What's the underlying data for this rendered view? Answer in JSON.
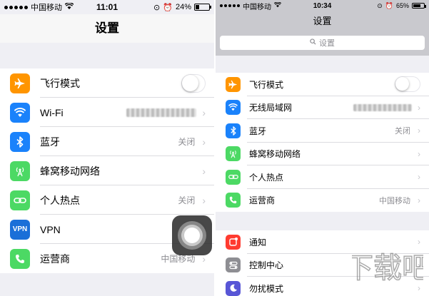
{
  "colors": {
    "airplane": "#ff9500",
    "wifi": "#1a82fb",
    "bluetooth": "#1a82fb",
    "cellular": "#4cd964",
    "hotspot": "#4cd964",
    "vpn": "#1a6fd8",
    "carrier": "#4cd964",
    "notifications": "#ff3b30",
    "control_center": "#8e8e93",
    "dnd": "#5856d6"
  },
  "left": {
    "status": {
      "carrier": "中国移动",
      "time": "11:01",
      "battery": "24%",
      "battery_level": 0.24
    },
    "title": "设置",
    "rows": [
      {
        "icon": "airplane-icon",
        "label": "飞行模式",
        "toggle": false
      },
      {
        "icon": "wifi-icon",
        "label": "Wi-Fi",
        "value_blurred": true
      },
      {
        "icon": "bluetooth-icon",
        "label": "蓝牙",
        "value": "关闭"
      },
      {
        "icon": "cellular-icon",
        "label": "蜂窝移动网络"
      },
      {
        "icon": "hotspot-icon",
        "label": "个人热点",
        "value": "关闭"
      },
      {
        "icon": "vpn-icon",
        "icon_text": "VPN",
        "label": "VPN",
        "toggle": false
      },
      {
        "icon": "phone-icon",
        "label": "运营商",
        "value": "中国移动"
      }
    ]
  },
  "right": {
    "status": {
      "carrier": "中国移动",
      "time": "10:34",
      "battery": "65%",
      "battery_level": 0.65
    },
    "title": "设置",
    "search_placeholder": "设置",
    "rows": [
      {
        "icon": "airplane-icon",
        "label": "飞行模式",
        "toggle": false
      },
      {
        "icon": "wifi-icon",
        "label": "无线局域网",
        "value_blurred": true
      },
      {
        "icon": "bluetooth-icon",
        "label": "蓝牙",
        "value": "关闭"
      },
      {
        "icon": "cellular-icon",
        "label": "蜂窝移动网络"
      },
      {
        "icon": "hotspot-icon",
        "label": "个人热点"
      },
      {
        "icon": "phone-icon",
        "label": "运营商",
        "value": "中国移动"
      }
    ],
    "rows2": [
      {
        "icon": "notifications-icon",
        "label": "通知"
      },
      {
        "icon": "control-center-icon",
        "label": "控制中心"
      },
      {
        "icon": "moon-icon",
        "label": "勿扰模式"
      }
    ]
  },
  "watermark": "下载吧"
}
